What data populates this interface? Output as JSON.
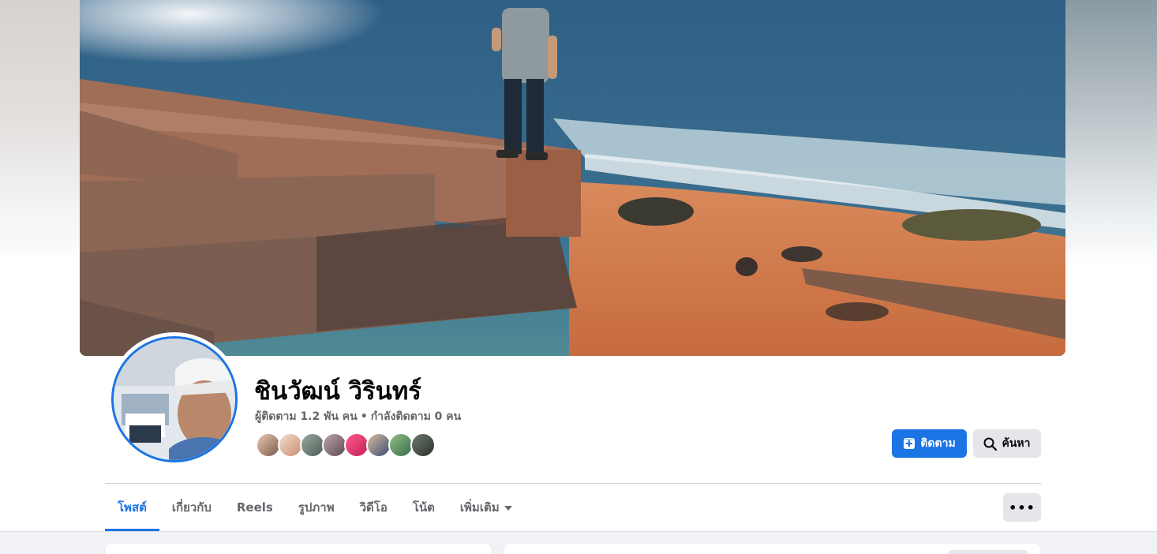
{
  "profile": {
    "name": "ชินวัฒน์ วิรินทร์",
    "followers": "ผู้ติดตาม 1.2 พัน คน",
    "separator": "•",
    "following": "กำลังติดตาม 0 คน"
  },
  "follower_faces": [
    {
      "icon": "follower-avatar-1"
    },
    {
      "icon": "follower-avatar-2"
    },
    {
      "icon": "follower-avatar-3"
    },
    {
      "icon": "follower-avatar-4"
    },
    {
      "icon": "follower-avatar-5"
    },
    {
      "icon": "follower-avatar-6"
    },
    {
      "icon": "follower-avatar-7"
    },
    {
      "icon": "follower-avatar-8"
    }
  ],
  "actions": {
    "follow_label": "ติดตาม",
    "follow_icon": "follow-plus-icon",
    "search_label": "ค้นหา",
    "search_icon": "search-icon"
  },
  "tabs": [
    {
      "label": "โพสต์",
      "active": true
    },
    {
      "label": "เกี่ยวกับ",
      "active": false
    },
    {
      "label": "Reels",
      "active": false
    },
    {
      "label": "รูปภาพ",
      "active": false
    },
    {
      "label": "วิดีโอ",
      "active": false
    },
    {
      "label": "โน้ต",
      "active": false
    },
    {
      "label": "เพิ่มเติม",
      "active": false,
      "icon": "caret-down-icon"
    }
  ],
  "more_button": {
    "label": "•••",
    "icon": "more-dots-icon"
  },
  "colors": {
    "accent": "#1b74e4",
    "secondary_button": "#e4e6eb",
    "muted_text": "#65676b",
    "feed_background": "#f0f2f5"
  }
}
